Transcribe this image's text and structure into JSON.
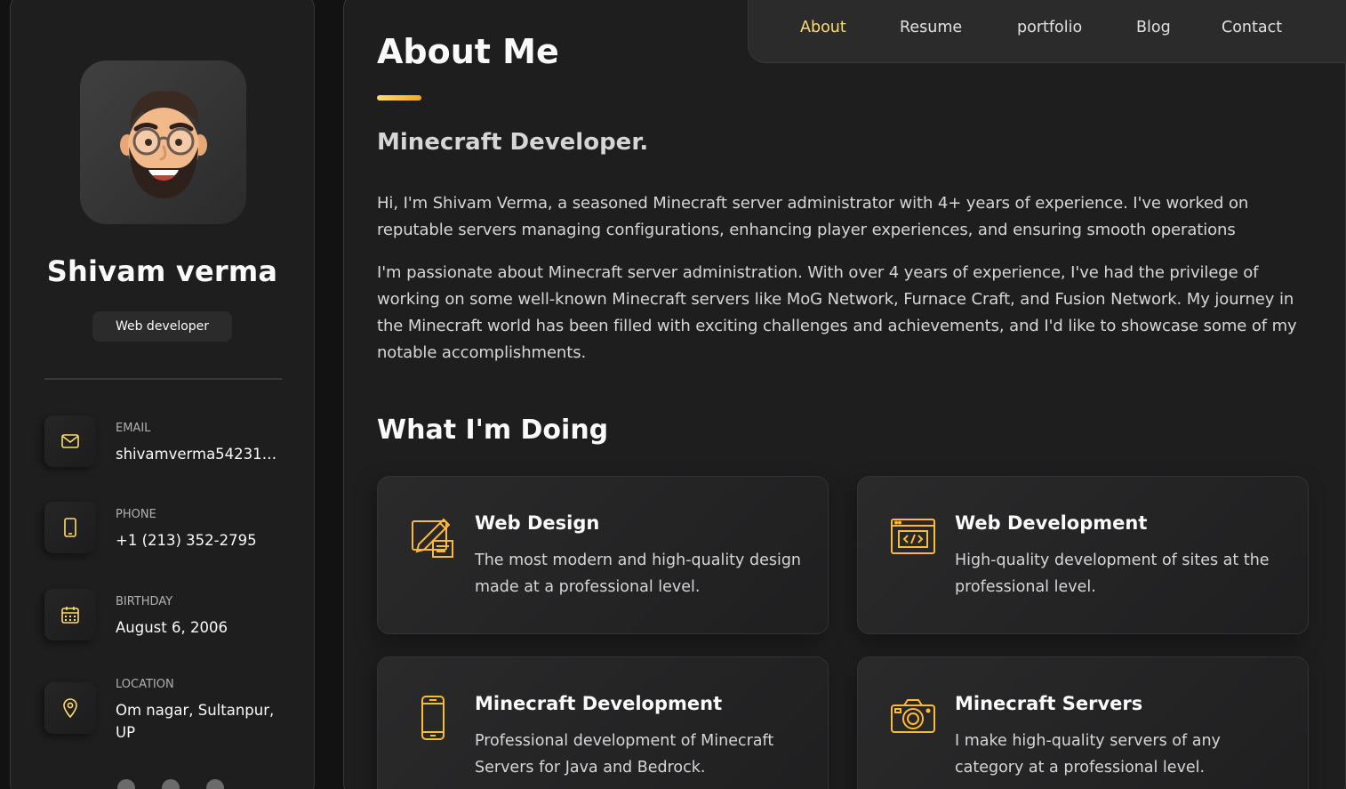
{
  "sidebar": {
    "name": "Shivam verma",
    "title": "Web developer",
    "contacts": [
      {
        "label": "EMAIL",
        "value": "shivamverma54231…",
        "icon": "mail-icon"
      },
      {
        "label": "PHONE",
        "value": "+1 (213) 352-2795",
        "icon": "phone-icon"
      },
      {
        "label": "BIRTHDAY",
        "value": "August 6, 2006",
        "icon": "calendar-icon"
      },
      {
        "label": "LOCATION",
        "value": "Om nagar, Sultanpur, UP",
        "icon": "location-pin-icon"
      }
    ]
  },
  "nav": {
    "items": [
      "About",
      "Resume",
      "portfolio",
      "Blog",
      "Contact"
    ],
    "active": "About"
  },
  "about": {
    "title": "About Me",
    "subtitle": "Minecraft Developer.",
    "paragraphs": [
      "Hi, I'm Shivam Verma, a seasoned Minecraft server administrator with 4+ years of experience. I've worked on reputable servers managing configurations, enhancing player experiences, and ensuring smooth operations",
      "I'm passionate about Minecraft server administration. With over 4 years of experience, I've had the privilege of working on some well-known Minecraft servers like MoG Network, Furnace Craft, and Fusion Network. My journey in the Minecraft world has been filled with exciting challenges and achievements, and I'd like to showcase some of my notable accomplishments."
    ]
  },
  "services": {
    "title": "What I'm Doing",
    "items": [
      {
        "title": "Web Design",
        "text": "The most modern and high-quality design made at a professional level.",
        "icon": "design-icon"
      },
      {
        "title": "Web Development",
        "text": "High-quality development of sites at the professional level.",
        "icon": "code-icon"
      },
      {
        "title": "Minecraft Development",
        "text": "Professional development of Minecraft Servers for Java and Bedrock.",
        "icon": "mobile-icon"
      },
      {
        "title": "Minecraft Servers",
        "text": "I make high-quality servers of any category at a professional level.",
        "icon": "camera-icon"
      }
    ]
  },
  "colors": {
    "accent": "#ffdb70",
    "background": "#121212",
    "panel": "#1e1e1f"
  }
}
